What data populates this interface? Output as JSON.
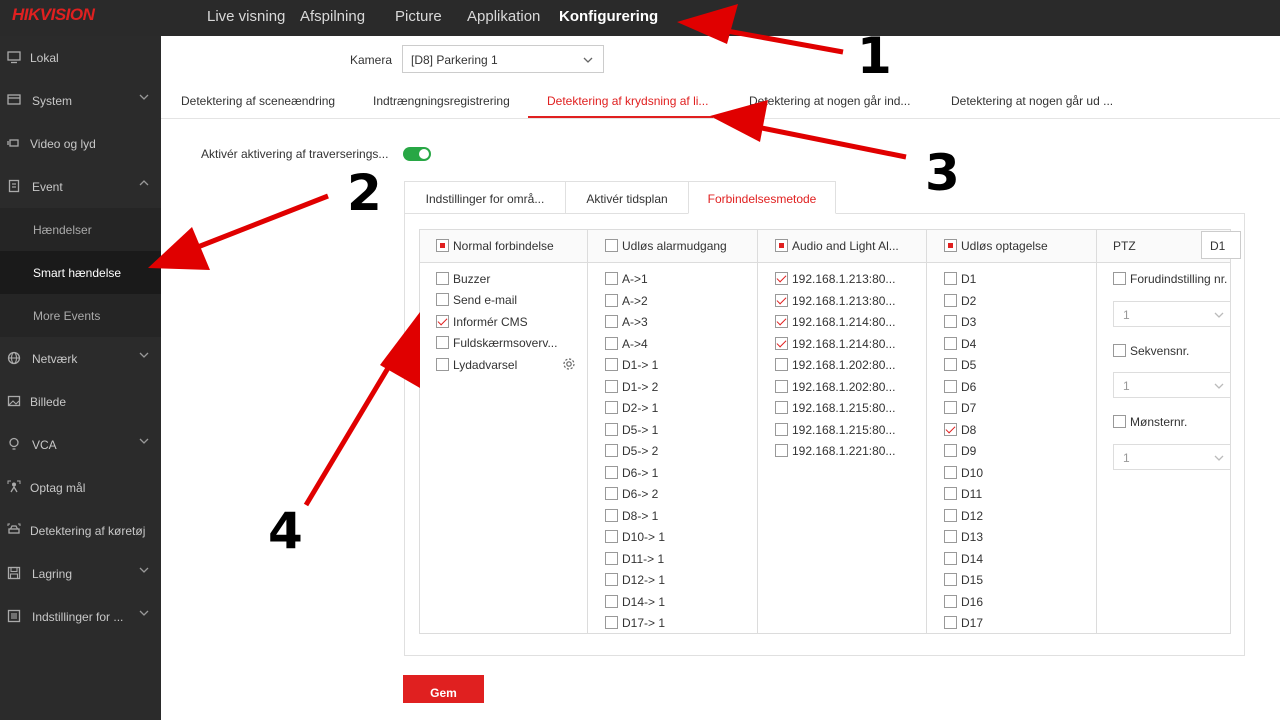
{
  "brand": {
    "logo": "HIKVISION",
    "accent": "#e02020"
  },
  "topnav": {
    "items": [
      "Live visning",
      "Afspilning",
      "Picture",
      "Applikation",
      "Konfigurering"
    ],
    "active": "Konfigurering"
  },
  "sidebar": {
    "items": [
      {
        "label": "Lokal",
        "icon": "monitor-icon"
      },
      {
        "label": "System",
        "icon": "system-icon"
      },
      {
        "label": "Video og lyd",
        "icon": "video-icon"
      },
      {
        "label": "Event",
        "icon": "event-icon"
      },
      {
        "label": "Hændelser"
      },
      {
        "label": "Smart hændelse"
      },
      {
        "label": "More Events"
      },
      {
        "label": "Netværk",
        "icon": "globe-icon"
      },
      {
        "label": "Billede",
        "icon": "image-icon"
      },
      {
        "label": "VCA",
        "icon": "bulb-icon"
      },
      {
        "label": "Optag mål",
        "icon": "person-target-icon"
      },
      {
        "label": "Detektering af køretøj",
        "icon": "vehicle-icon"
      },
      {
        "label": "Lagring",
        "icon": "storage-icon"
      },
      {
        "label": "Indstillinger for ...",
        "icon": "settings-panel-icon"
      }
    ]
  },
  "camera": {
    "label": "Kamera",
    "selected": "[D8] Parkering 1"
  },
  "tabs": [
    "Detektering af sceneændring",
    "Indtrængningsregistrering",
    "Detektering af krydsning af li...",
    "Detektering at nogen går ind...",
    "Detektering at nogen går ud ..."
  ],
  "enable": {
    "label": "Aktivér aktivering af traverserings...",
    "on": true
  },
  "subtabs": [
    "Indstillinger for områ...",
    "Aktivér tidsplan",
    "Forbindelsesmetode"
  ],
  "columns": {
    "normal": {
      "header": "Normal forbindelse",
      "items": [
        {
          "label": "Buzzer",
          "checked": false
        },
        {
          "label": "Send e-mail",
          "checked": false
        },
        {
          "label": "Informér CMS",
          "checked": true
        },
        {
          "label": "Fuldskærmsoverv...",
          "checked": false
        },
        {
          "label": "Lydadvarsel",
          "checked": false
        }
      ]
    },
    "alarm": {
      "header": "Udløs alarmudgang",
      "items": [
        "A->1",
        "A->2",
        "A->3",
        "A->4",
        "D1-> 1",
        "D1-> 2",
        "D2-> 1",
        "D5-> 1",
        "D5-> 2",
        "D6-> 1",
        "D6-> 2",
        "D8-> 1",
        "D10-> 1",
        "D11-> 1",
        "D12-> 1",
        "D14-> 1",
        "D17-> 1"
      ]
    },
    "audio": {
      "header": "Audio and Light Al...",
      "items": [
        {
          "label": "192.168.1.213:80...",
          "checked": true
        },
        {
          "label": "192.168.1.213:80...",
          "checked": true
        },
        {
          "label": "192.168.1.214:80...",
          "checked": true
        },
        {
          "label": "192.168.1.214:80...",
          "checked": true
        },
        {
          "label": "192.168.1.202:80...",
          "checked": false
        },
        {
          "label": "192.168.1.202:80...",
          "checked": false
        },
        {
          "label": "192.168.1.215:80...",
          "checked": false
        },
        {
          "label": "192.168.1.215:80...",
          "checked": false
        },
        {
          "label": "192.168.1.221:80...",
          "checked": false
        }
      ]
    },
    "record": {
      "header": "Udløs optagelse",
      "items": [
        "D1",
        "D2",
        "D3",
        "D4",
        "D5",
        "D6",
        "D7",
        "D8",
        "D9",
        "D10",
        "D11",
        "D12",
        "D13",
        "D14",
        "D15",
        "D16",
        "D17"
      ],
      "checked": [
        "D8"
      ]
    },
    "ptz": {
      "header": "PTZ",
      "channel": "D1",
      "options": [
        {
          "label": "Forudindstilling nr.",
          "value": "1"
        },
        {
          "label": "Sekvensnr.",
          "value": "1"
        },
        {
          "label": "Mønsternr.",
          "value": "1"
        }
      ]
    }
  },
  "save": {
    "label": "Gem"
  },
  "annotations": [
    "1",
    "2",
    "3",
    "4"
  ]
}
